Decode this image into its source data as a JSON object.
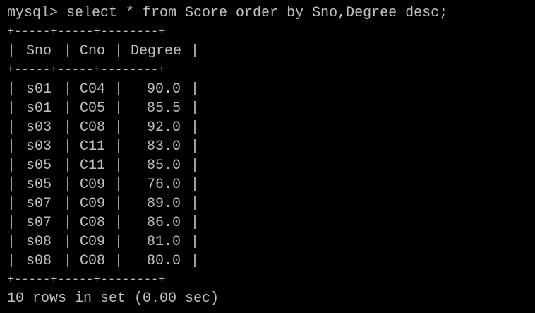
{
  "prompt": {
    "text": "mysql> select * from Score order by Sno,Degree desc;"
  },
  "table": {
    "border": "+-----+-----+--------+",
    "headers": {
      "sno": "Sno",
      "cno": "Cno",
      "degree": "Degree"
    },
    "rows": [
      {
        "sno": "s01",
        "cno": "C04",
        "degree": "90.0"
      },
      {
        "sno": "s01",
        "cno": "C05",
        "degree": "85.5"
      },
      {
        "sno": "s03",
        "cno": "C08",
        "degree": "92.0"
      },
      {
        "sno": "s03",
        "cno": "C11",
        "degree": "83.0"
      },
      {
        "sno": "s05",
        "cno": "C11",
        "degree": "85.0"
      },
      {
        "sno": "s05",
        "cno": "C09",
        "degree": "76.0"
      },
      {
        "sno": "s07",
        "cno": "C09",
        "degree": "89.0"
      },
      {
        "sno": "s07",
        "cno": "C08",
        "degree": "86.0"
      },
      {
        "sno": "s08",
        "cno": "C09",
        "degree": "81.0"
      },
      {
        "sno": "s08",
        "cno": "C08",
        "degree": "80.0"
      }
    ]
  },
  "footer": {
    "text": "10 rows in set (0.00 sec)"
  },
  "colors": {
    "background": "#000000",
    "foreground": "#c0c0c0"
  }
}
